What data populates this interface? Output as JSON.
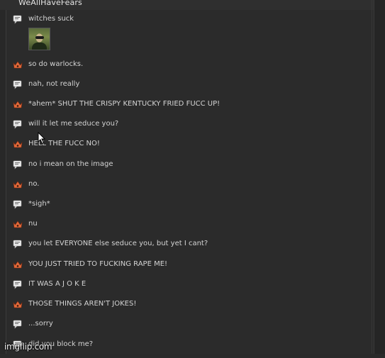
{
  "channel": {
    "name": "WeAllHaveFears"
  },
  "watermark": "imgflip.com",
  "colors": {
    "background": "#2b2b2b",
    "text": "#d4d4d4",
    "crown": "#e0683a"
  },
  "icons": {
    "speech": "chat-bubble-icon",
    "crown": "crown-icon"
  },
  "messages": [
    {
      "icon": "speech",
      "text": "witches suck"
    },
    {
      "icon": "crown",
      "text": "so do warlocks."
    },
    {
      "icon": "speech",
      "text": "nah, not really"
    },
    {
      "icon": "crown",
      "text": "*ahem* SHUT THE CRISPY KENTUCKY FRIED FUCC UP!"
    },
    {
      "icon": "speech",
      "text": "will it let me seduce you?"
    },
    {
      "icon": "crown",
      "text": "HELL THE FUCC NO!"
    },
    {
      "icon": "speech",
      "text": "no i mean on the image"
    },
    {
      "icon": "crown",
      "text": "no."
    },
    {
      "icon": "speech",
      "text": "*sigh*"
    },
    {
      "icon": "crown",
      "text": "nu"
    },
    {
      "icon": "speech",
      "text": "you let EVERYONE else seduce you, but yet I cant?"
    },
    {
      "icon": "crown",
      "text": "YOU JUST TRIED TO FUCKING RAPE ME!"
    },
    {
      "icon": "speech",
      "text": "IT WAS A J O K E"
    },
    {
      "icon": "crown",
      "text": "THOSE THINGS AREN'T JOKES!"
    },
    {
      "icon": "speech",
      "text": "...sorry"
    },
    {
      "icon": "speech",
      "text": "did you block me?"
    }
  ]
}
